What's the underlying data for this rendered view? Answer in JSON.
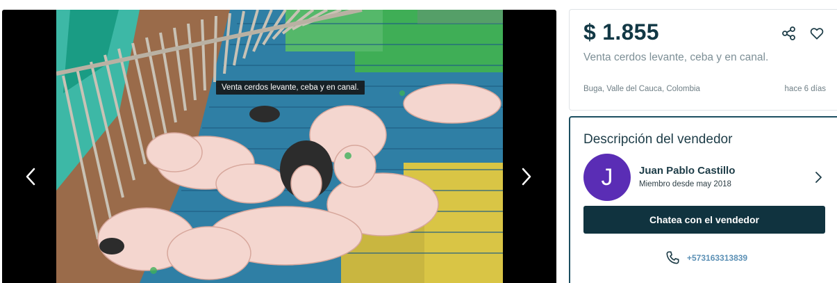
{
  "gallery": {
    "caption": "Venta cerdos levante, ceba y en canal.",
    "prev_icon": "chevron-left-icon",
    "next_icon": "chevron-right-icon"
  },
  "listing": {
    "price": "$ 1.855",
    "title": "Venta cerdos levante, ceba y en canal.",
    "location": "Buga, Valle del Cauca, Colombia",
    "posted": "hace 6 días",
    "share_icon": "share-icon",
    "favorite_icon": "heart-icon"
  },
  "seller": {
    "section_title": "Descripción del vendedor",
    "avatar_letter": "J",
    "name": "Juan Pablo Castillo",
    "member_since": "Miembro desde may 2018",
    "chat_label": "Chatea con el vendedor",
    "phone": "+573163313839",
    "avatar_color": "#5a2db5",
    "button_color": "#10333f"
  }
}
